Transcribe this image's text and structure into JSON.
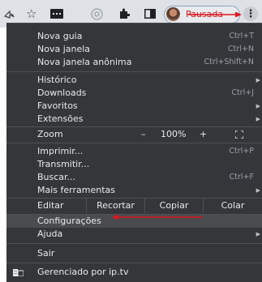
{
  "toolbar": {
    "icons": [
      "share-icon",
      "star-icon",
      "extension-icon",
      "chrome-icon",
      "puzzle-icon",
      "sidepanel-icon"
    ],
    "profile_label": "Pausada",
    "menu_button": "⋮"
  },
  "menu": {
    "new_tab": {
      "label": "Nova guia",
      "shortcut": "Ctrl+T"
    },
    "new_window": {
      "label": "Nova janela",
      "shortcut": "Ctrl+N"
    },
    "new_incognito": {
      "label": "Nova janela anônima",
      "shortcut": "Ctrl+Shift+N"
    },
    "history": {
      "label": "Histórico"
    },
    "downloads": {
      "label": "Downloads",
      "shortcut": "Ctrl+J"
    },
    "bookmarks": {
      "label": "Favoritos"
    },
    "extensions": {
      "label": "Extensões"
    },
    "zoom": {
      "label": "Zoom",
      "minus": "–",
      "value": "100%",
      "plus": "+"
    },
    "print": {
      "label": "Imprimir...",
      "shortcut": "Ctrl+P"
    },
    "cast": {
      "label": "Transmitir..."
    },
    "find": {
      "label": "Buscar...",
      "shortcut": "Ctrl+F"
    },
    "more_tools": {
      "label": "Mais ferramentas"
    },
    "edit": {
      "label": "Editar",
      "cut": "Recortar",
      "copy": "Copiar",
      "paste": "Colar"
    },
    "settings": {
      "label": "Configurações"
    },
    "help": {
      "label": "Ajuda"
    },
    "exit": {
      "label": "Sair"
    },
    "managed": {
      "label": "Gerenciado por ip.tv"
    }
  },
  "colors": {
    "menu_bg": "#35363a",
    "annotation_red": "#e0141c"
  }
}
